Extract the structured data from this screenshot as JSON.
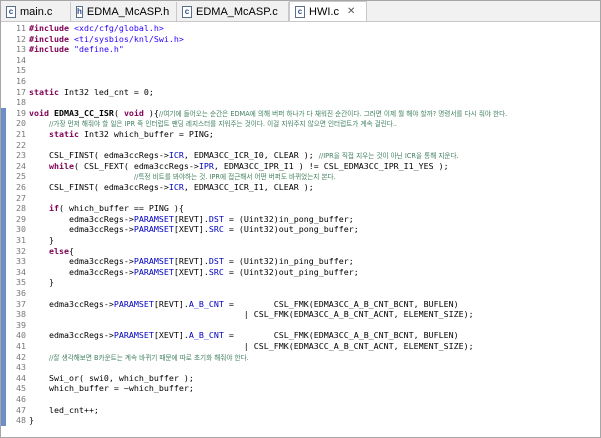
{
  "tabs": [
    {
      "label": "main.c",
      "icon": "c-source-file-icon",
      "active": false
    },
    {
      "label": "EDMA_McASP.h",
      "icon": "c-header-file-icon",
      "active": false
    },
    {
      "label": "EDMA_McASP.c",
      "icon": "c-source-file-icon",
      "active": false
    },
    {
      "label": "HWI.c",
      "icon": "c-source-file-icon",
      "active": true
    }
  ],
  "lines": [
    {
      "n": "11",
      "seg": [
        {
          "t": "#include ",
          "c": "pp"
        },
        {
          "t": "<xdc/cfg/global.h>",
          "c": "str"
        }
      ]
    },
    {
      "n": "12",
      "seg": [
        {
          "t": "#include ",
          "c": "pp"
        },
        {
          "t": "<ti/sysbios/knl/Swi.h>",
          "c": "str"
        }
      ]
    },
    {
      "n": "13",
      "seg": [
        {
          "t": "#include ",
          "c": "pp"
        },
        {
          "t": "\"define.h\"",
          "c": "str"
        }
      ]
    },
    {
      "n": "14",
      "seg": []
    },
    {
      "n": "15",
      "seg": []
    },
    {
      "n": "16",
      "seg": []
    },
    {
      "n": "17",
      "seg": [
        {
          "t": "static ",
          "c": "kw"
        },
        {
          "t": "Int32 led_cnt = 0;",
          "c": ""
        }
      ]
    },
    {
      "n": "18",
      "seg": []
    },
    {
      "n": "19",
      "seg": [
        {
          "t": "void ",
          "c": "kw"
        },
        {
          "t": "EDMA3_CC_ISR",
          "c": "fn"
        },
        {
          "t": "( ",
          "c": ""
        },
        {
          "t": "void ",
          "c": "kw"
        },
        {
          "t": "){",
          "c": ""
        },
        {
          "t": "//여기에 들어오는 순간은 EDMA에 의해 버퍼 하나가 다 채워진 순간이다. 그러면 이제 뭘 해야 할까? 명령서를 다시 줘야 한다.",
          "c": "cm sm"
        }
      ]
    },
    {
      "n": "20",
      "seg": [
        {
          "t": "    ",
          "c": ""
        },
        {
          "t": "//가장 먼저 해줘야 할 일은 IPR 즉 인터럽트 팬딩 레지스터를 지워주는 것이다. 이걸 지워주지 않으면 인터럽트가 계속 걸린다..",
          "c": "cm sm"
        }
      ]
    },
    {
      "n": "21",
      "seg": [
        {
          "t": "    ",
          "c": ""
        },
        {
          "t": "static ",
          "c": "kw"
        },
        {
          "t": "Int32 which_buffer = PING;",
          "c": ""
        }
      ]
    },
    {
      "n": "22",
      "seg": []
    },
    {
      "n": "23",
      "seg": [
        {
          "t": "    CSL_FINST( edma3ccRegs->",
          "c": ""
        },
        {
          "t": "ICR",
          "c": "fld"
        },
        {
          "t": ", EDMA3CC_ICR_I0, CLEAR ); ",
          "c": ""
        },
        {
          "t": "//IPR을 직접 지우는 것이 아닌 ICR을 통해 지운다.",
          "c": "cm sm"
        }
      ]
    },
    {
      "n": "24",
      "seg": [
        {
          "t": "    ",
          "c": ""
        },
        {
          "t": "while",
          "c": "kw"
        },
        {
          "t": "( CSL_FEXT( edma3ccRegs->",
          "c": ""
        },
        {
          "t": "IPR",
          "c": "fld"
        },
        {
          "t": ", EDMA3CC_IPR_I1 ) != CSL_EDMA3CC_IPR_I1_YES );",
          "c": ""
        }
      ]
    },
    {
      "n": "25",
      "seg": [
        {
          "t": "                     ",
          "c": ""
        },
        {
          "t": "//특정 비트를 봐야하는 것. IPR에 접근해서 어떤 버퍼도 바뀌었는지 본다.",
          "c": "cm sm"
        }
      ]
    },
    {
      "n": "26",
      "seg": [
        {
          "t": "    CSL_FINST( edma3ccRegs->",
          "c": ""
        },
        {
          "t": "ICR",
          "c": "fld"
        },
        {
          "t": ", EDMA3CC_ICR_I1, CLEAR );",
          "c": ""
        }
      ]
    },
    {
      "n": "27",
      "seg": []
    },
    {
      "n": "28",
      "seg": [
        {
          "t": "    ",
          "c": ""
        },
        {
          "t": "if",
          "c": "kw"
        },
        {
          "t": "( which_buffer == PING ){",
          "c": ""
        }
      ]
    },
    {
      "n": "29",
      "seg": [
        {
          "t": "        edma3ccRegs->",
          "c": ""
        },
        {
          "t": "PARAMSET",
          "c": "fld"
        },
        {
          "t": "[REVT].",
          "c": ""
        },
        {
          "t": "DST",
          "c": "fld"
        },
        {
          "t": " = (Uint32)in_pong_buffer;",
          "c": ""
        }
      ]
    },
    {
      "n": "30",
      "seg": [
        {
          "t": "        edma3ccRegs->",
          "c": ""
        },
        {
          "t": "PARAMSET",
          "c": "fld"
        },
        {
          "t": "[XEVT].",
          "c": ""
        },
        {
          "t": "SRC",
          "c": "fld"
        },
        {
          "t": " = (Uint32)out_pong_buffer;",
          "c": ""
        }
      ]
    },
    {
      "n": "31",
      "seg": [
        {
          "t": "    }",
          "c": ""
        }
      ]
    },
    {
      "n": "32",
      "seg": [
        {
          "t": "    ",
          "c": ""
        },
        {
          "t": "else",
          "c": "kw"
        },
        {
          "t": "{",
          "c": ""
        }
      ]
    },
    {
      "n": "33",
      "seg": [
        {
          "t": "        edma3ccRegs->",
          "c": ""
        },
        {
          "t": "PARAMSET",
          "c": "fld"
        },
        {
          "t": "[REVT].",
          "c": ""
        },
        {
          "t": "DST",
          "c": "fld"
        },
        {
          "t": " = (Uint32)in_ping_buffer;",
          "c": ""
        }
      ]
    },
    {
      "n": "34",
      "seg": [
        {
          "t": "        edma3ccRegs->",
          "c": ""
        },
        {
          "t": "PARAMSET",
          "c": "fld"
        },
        {
          "t": "[XEVT].",
          "c": ""
        },
        {
          "t": "SRC",
          "c": "fld"
        },
        {
          "t": " = (Uint32)out_ping_buffer;",
          "c": ""
        }
      ]
    },
    {
      "n": "35",
      "seg": [
        {
          "t": "    }",
          "c": ""
        }
      ]
    },
    {
      "n": "36",
      "seg": []
    },
    {
      "n": "37",
      "seg": [
        {
          "t": "    edma3ccRegs->",
          "c": ""
        },
        {
          "t": "PARAMSET",
          "c": "fld"
        },
        {
          "t": "[REVT].",
          "c": ""
        },
        {
          "t": "A_B_CNT",
          "c": "fld"
        },
        {
          "t": " =        CSL_FMK(EDMA3CC_A_B_CNT_BCNT, BUFLEN)",
          "c": ""
        }
      ]
    },
    {
      "n": "38",
      "seg": [
        {
          "t": "                                           | CSL_FMK(EDMA3CC_A_B_CNT_ACNT, ELEMENT_SIZE);",
          "c": ""
        }
      ]
    },
    {
      "n": "39",
      "seg": []
    },
    {
      "n": "40",
      "seg": [
        {
          "t": "    edma3ccRegs->",
          "c": ""
        },
        {
          "t": "PARAMSET",
          "c": "fld"
        },
        {
          "t": "[XEVT].",
          "c": ""
        },
        {
          "t": "A_B_CNT",
          "c": "fld"
        },
        {
          "t": " =        CSL_FMK(EDMA3CC_A_B_CNT_BCNT, BUFLEN)",
          "c": ""
        }
      ]
    },
    {
      "n": "41",
      "seg": [
        {
          "t": "                                           | CSL_FMK(EDMA3CC_A_B_CNT_ACNT, ELEMENT_SIZE);",
          "c": ""
        }
      ]
    },
    {
      "n": "42",
      "seg": [
        {
          "t": "    ",
          "c": ""
        },
        {
          "t": "//잘 생각해보면 B카운트는 계속 바뀌기 때문에 따로 초기화 해줘야 한다.",
          "c": "cm sm"
        }
      ]
    },
    {
      "n": "43",
      "seg": []
    },
    {
      "n": "44",
      "seg": [
        {
          "t": "    Swi_or( swi0, which_buffer );",
          "c": ""
        }
      ]
    },
    {
      "n": "45",
      "seg": [
        {
          "t": "    which_buffer = ~which_buffer;",
          "c": ""
        }
      ]
    },
    {
      "n": "46",
      "seg": []
    },
    {
      "n": "47",
      "seg": [
        {
          "t": "    led_cnt++;",
          "c": ""
        }
      ]
    },
    {
      "n": "48",
      "seg": [
        {
          "t": "}",
          "c": ""
        }
      ]
    }
  ],
  "colors": {
    "change_bar": "#6c8fc7",
    "keyword": "#7f0055",
    "string": "#2a00ff",
    "comment": "#3f7f5f",
    "field": "#0000c0"
  }
}
